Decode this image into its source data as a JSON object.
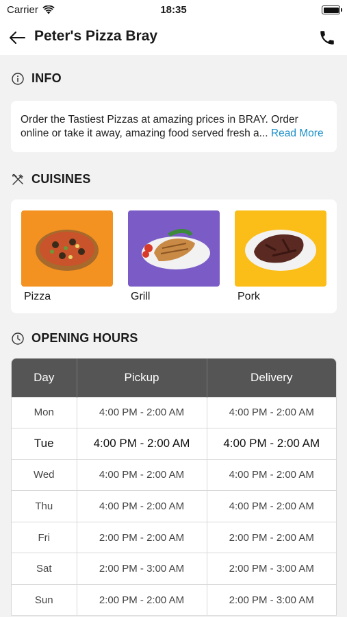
{
  "status": {
    "carrier": "Carrier",
    "time": "18:35"
  },
  "nav": {
    "title": "Peter's Pizza Bray"
  },
  "info": {
    "heading": "INFO",
    "text": "Order the Tastiest Pizzas at amazing prices in BRAY. Order online or take it away, amazing food served fresh a...",
    "read_more": "Read More"
  },
  "cuisines": {
    "heading": "CUISINES",
    "items": [
      {
        "label": "Pizza",
        "color": "#f39221"
      },
      {
        "label": "Grill",
        "color": "#7b5cc7"
      },
      {
        "label": "Pork",
        "color": "#fbbd18"
      }
    ]
  },
  "hours": {
    "heading": "OPENING HOURS",
    "columns": [
      "Day",
      "Pickup",
      "Delivery"
    ],
    "today": "Tue",
    "rows": [
      {
        "day": "Mon",
        "pickup": "4:00 PM - 2:00 AM",
        "delivery": "4:00 PM - 2:00 AM"
      },
      {
        "day": "Tue",
        "pickup": "4:00 PM - 2:00 AM",
        "delivery": "4:00 PM - 2:00 AM"
      },
      {
        "day": "Wed",
        "pickup": "4:00 PM - 2:00 AM",
        "delivery": "4:00 PM - 2:00 AM"
      },
      {
        "day": "Thu",
        "pickup": "4:00 PM - 2:00 AM",
        "delivery": "4:00 PM - 2:00 AM"
      },
      {
        "day": "Fri",
        "pickup": "2:00 PM - 2:00 AM",
        "delivery": "2:00 PM - 2:00 AM"
      },
      {
        "day": "Sat",
        "pickup": "2:00 PM - 3:00 AM",
        "delivery": "2:00 PM - 3:00 AM"
      },
      {
        "day": "Sun",
        "pickup": "2:00 PM - 2:00 AM",
        "delivery": "2:00 PM - 3:00 AM"
      }
    ]
  },
  "icons": {
    "wifi": "wifi-icon",
    "battery": "battery-icon",
    "back": "arrow-left-icon",
    "phone": "phone-icon",
    "info": "info-circle-icon",
    "cuisines": "utensils-icon",
    "clock": "clock-icon"
  }
}
